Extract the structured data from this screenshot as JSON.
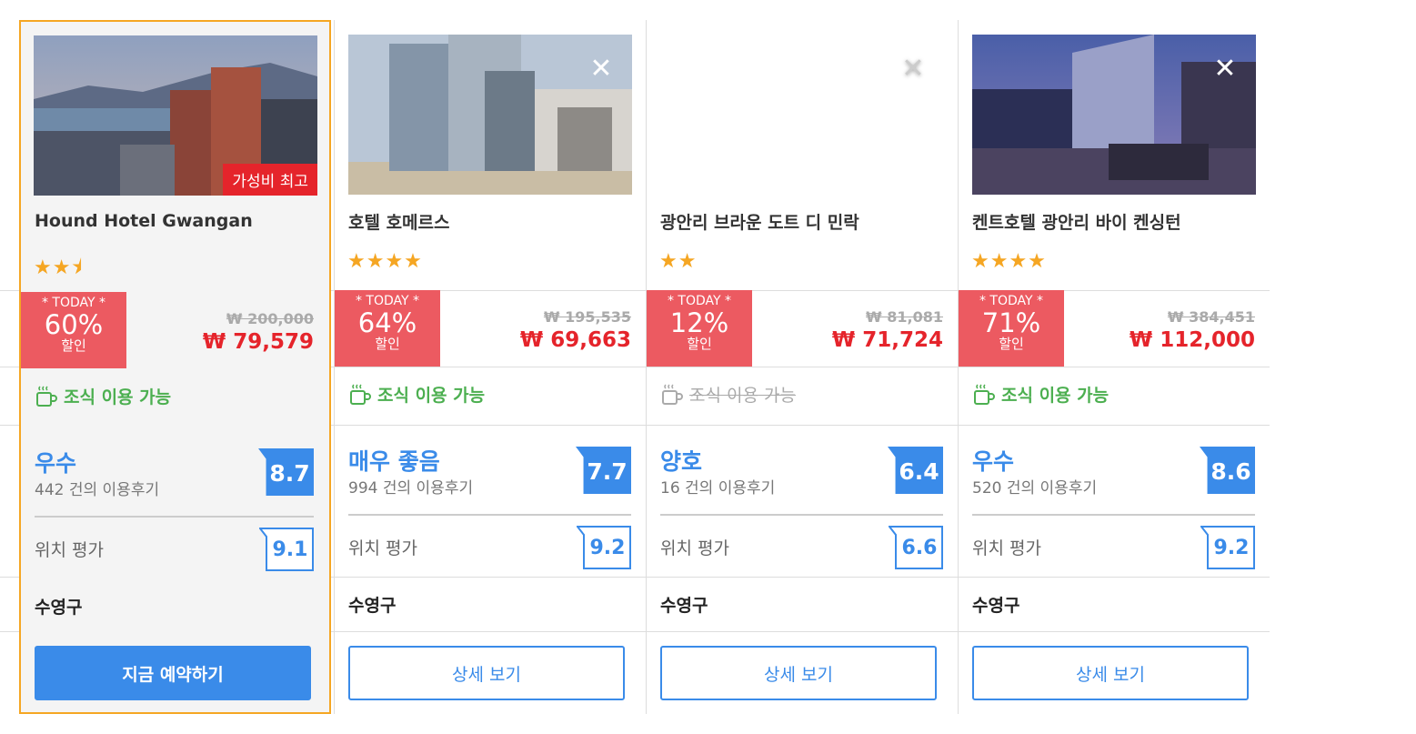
{
  "cards": [
    {
      "name": "Hound Hotel Gwangan",
      "stars": "★★⯨",
      "tag": "가성비 최고",
      "today_label": "* TODAY *",
      "discount": "60%",
      "discount_suffix": "할인",
      "original_price": "₩ 200,000",
      "price": "₩ 79,579",
      "breakfast": "조식 이용 가능",
      "rating_label": "우수",
      "reviews": "442 건의 이용후기",
      "score": "8.7",
      "location_label": "위치 평가",
      "location_score": "9.1",
      "district": "수영구",
      "button": "지금 예약하기"
    },
    {
      "name": "호텔 호메르스",
      "stars": "★★★★",
      "today_label": "* TODAY *",
      "discount": "64%",
      "discount_suffix": "할인",
      "original_price": "₩ 195,535",
      "price": "₩ 69,663",
      "breakfast": "조식 이용 가능",
      "rating_label": "매우 좋음",
      "reviews": "994 건의 이용후기",
      "score": "7.7",
      "location_label": "위치 평가",
      "location_score": "9.2",
      "district": "수영구",
      "button": "상세 보기"
    },
    {
      "name": "광안리 브라운 도트 디 민락",
      "stars": "★★",
      "today_label": "* TODAY *",
      "discount": "12%",
      "discount_suffix": "할인",
      "original_price": "₩ 81,081",
      "price": "₩ 71,724",
      "breakfast": "조식 이용 가능",
      "rating_label": "양호",
      "reviews": "16 건의 이용후기",
      "score": "6.4",
      "location_label": "위치 평가",
      "location_score": "6.6",
      "district": "수영구",
      "button": "상세 보기"
    },
    {
      "name": "켄트호텔 광안리 바이 켄싱턴",
      "stars": "★★★★",
      "today_label": "* TODAY *",
      "discount": "71%",
      "discount_suffix": "할인",
      "original_price": "₩ 384,451",
      "price": "₩ 112,000",
      "breakfast": "조식 이용 가능",
      "rating_label": "우수",
      "reviews": "520 건의 이용후기",
      "score": "8.6",
      "location_label": "위치 평가",
      "location_score": "9.2",
      "district": "수영구",
      "button": "상세 보기"
    }
  ],
  "close_symbol": "✕",
  "colors": {
    "accent_blue": "#3a8be9",
    "sale_red": "#e5242b",
    "today_bg": "#ec5a61",
    "breakfast_green": "#4caf50",
    "featured_border": "#f5a623"
  }
}
